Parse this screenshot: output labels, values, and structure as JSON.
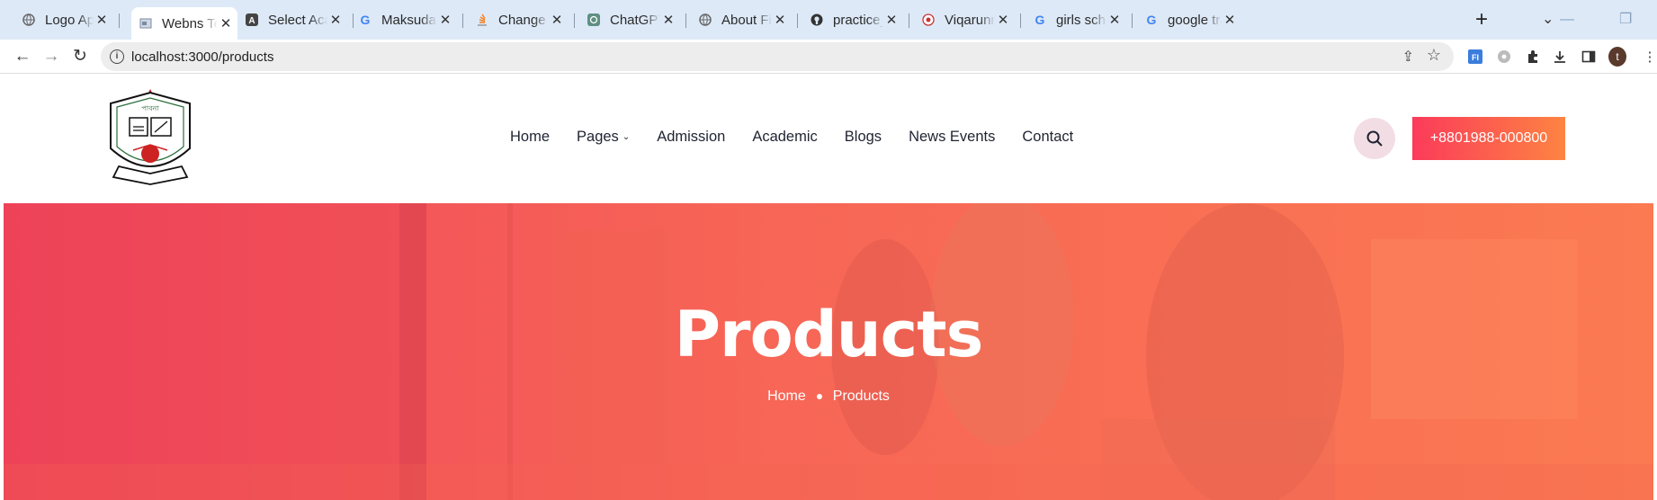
{
  "browser": {
    "tabs": [
      {
        "title": "Logo Api – I",
        "icon": "globe-icon"
      },
      {
        "title": "Webns Tech",
        "icon": "page-icon",
        "active": true
      },
      {
        "title": "Select Acad",
        "icon": "letter-a-icon"
      },
      {
        "title": "Maksuda Gh",
        "icon": "google-icon"
      },
      {
        "title": "Change mo",
        "icon": "stackoverflow-icon"
      },
      {
        "title": "ChatGPT",
        "icon": "chatgpt-icon"
      },
      {
        "title": "About File U",
        "icon": "globe-icon"
      },
      {
        "title": "practice_py",
        "icon": "github-icon"
      },
      {
        "title": "Viqarunnis",
        "icon": "school-icon"
      },
      {
        "title": "girls school",
        "icon": "google-icon"
      },
      {
        "title": "google tran",
        "icon": "google-icon"
      }
    ],
    "url": "localhost:3000/products",
    "profile_initial": "t"
  },
  "site": {
    "logo_text": "পাবনা",
    "nav": [
      {
        "label": "Home"
      },
      {
        "label": "Pages",
        "dropdown": true
      },
      {
        "label": "Admission"
      },
      {
        "label": "Academic"
      },
      {
        "label": "Blogs"
      },
      {
        "label": "News Events"
      },
      {
        "label": "Contact"
      }
    ],
    "phone": "+8801988-000800"
  },
  "hero": {
    "title": "Products",
    "breadcrumb": [
      "Home",
      "Products"
    ]
  },
  "colors": {
    "accent_start": "#fb3b5a",
    "accent_end": "#fd8442",
    "search_bg": "#f3dde4"
  }
}
